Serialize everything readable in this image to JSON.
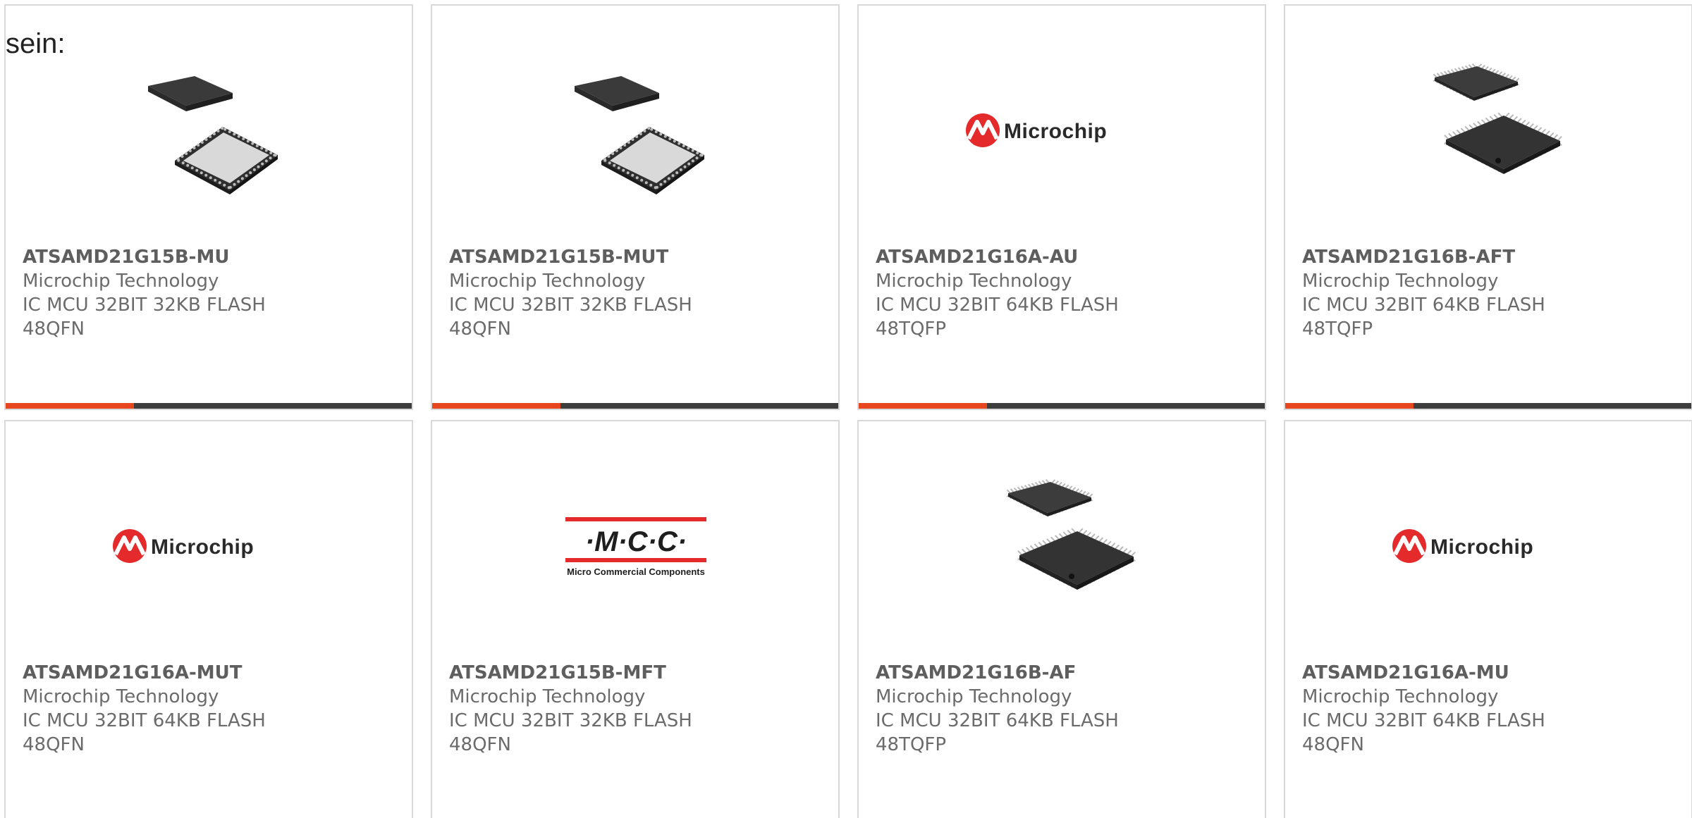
{
  "intro_text": "sein:",
  "colors": {
    "accent": "#e8461e",
    "bar_dark": "#3d3d3d"
  },
  "cards": [
    {
      "part_number": "ATSAMD21G15B-MU",
      "manufacturer": "Microchip Technology",
      "description_line1": "IC MCU 32BIT 32KB FLASH",
      "description_line2": "48QFN",
      "image": "qfn-chip"
    },
    {
      "part_number": "ATSAMD21G15B-MUT",
      "manufacturer": "Microchip Technology",
      "description_line1": "IC MCU 32BIT 32KB FLASH",
      "description_line2": "48QFN",
      "image": "qfn-chip"
    },
    {
      "part_number": "ATSAMD21G16A-AU",
      "manufacturer": "Microchip Technology",
      "description_line1": "IC MCU 32BIT 64KB FLASH",
      "description_line2": "48TQFP",
      "image": "microchip-logo",
      "logo_text": "Microchip"
    },
    {
      "part_number": "ATSAMD21G16B-AFT",
      "manufacturer": "Microchip Technology",
      "description_line1": "IC MCU 32BIT 64KB FLASH",
      "description_line2": "48TQFP",
      "image": "tqfp-chip"
    },
    {
      "part_number": "ATSAMD21G16A-MUT",
      "manufacturer": "Microchip Technology",
      "description_line1": "IC MCU 32BIT 64KB FLASH",
      "description_line2": "48QFN",
      "image": "microchip-logo",
      "logo_text": "Microchip"
    },
    {
      "part_number": "ATSAMD21G15B-MFT",
      "manufacturer": "Microchip Technology",
      "description_line1": "IC MCU 32BIT 32KB FLASH",
      "description_line2": "48QFN",
      "image": "mcc-logo",
      "logo_text": "·M·C·C·",
      "logo_subtext": "Micro Commercial Components"
    },
    {
      "part_number": "ATSAMD21G16B-AF",
      "manufacturer": "Microchip Technology",
      "description_line1": "IC MCU 32BIT 64KB FLASH",
      "description_line2": "48TQFP",
      "image": "tqfp-chip"
    },
    {
      "part_number": "ATSAMD21G16A-MU",
      "manufacturer": "Microchip Technology",
      "description_line1": "IC MCU 32BIT 64KB FLASH",
      "description_line2": "48QFN",
      "image": "microchip-logo",
      "logo_text": "Microchip"
    }
  ]
}
